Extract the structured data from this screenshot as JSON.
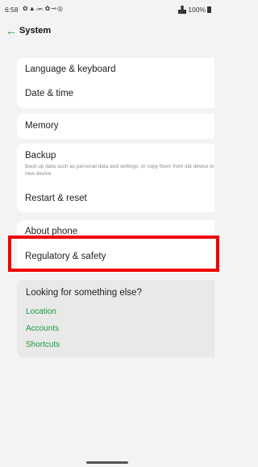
{
  "status_bar": {
    "time": "6:58",
    "icons": [
      "gear-icon",
      "warning-icon",
      "cat-icon",
      "gear-icon",
      "key-icon",
      "circle-icon"
    ],
    "signal": "▗▙",
    "battery": "100%"
  },
  "header": {
    "back_icon": "arrow-left-icon",
    "title": "System"
  },
  "settings": {
    "language": "Language & keyboard",
    "datetime": "Date & time",
    "memory": "Memory",
    "backup": {
      "label": "Backup",
      "description": "Back up data such as personal data and settings, or copy them from old device to new device"
    },
    "restart": "Restart & reset",
    "about": "About phone",
    "regulatory": "Regulatory & safety"
  },
  "looking_else": {
    "title": "Looking for something else?",
    "links": [
      "Location",
      "Accounts",
      "Shortcuts"
    ]
  },
  "colors": {
    "accent": "#1a9c3d",
    "highlight": "#ee0000",
    "background": "#f3f3f3"
  }
}
